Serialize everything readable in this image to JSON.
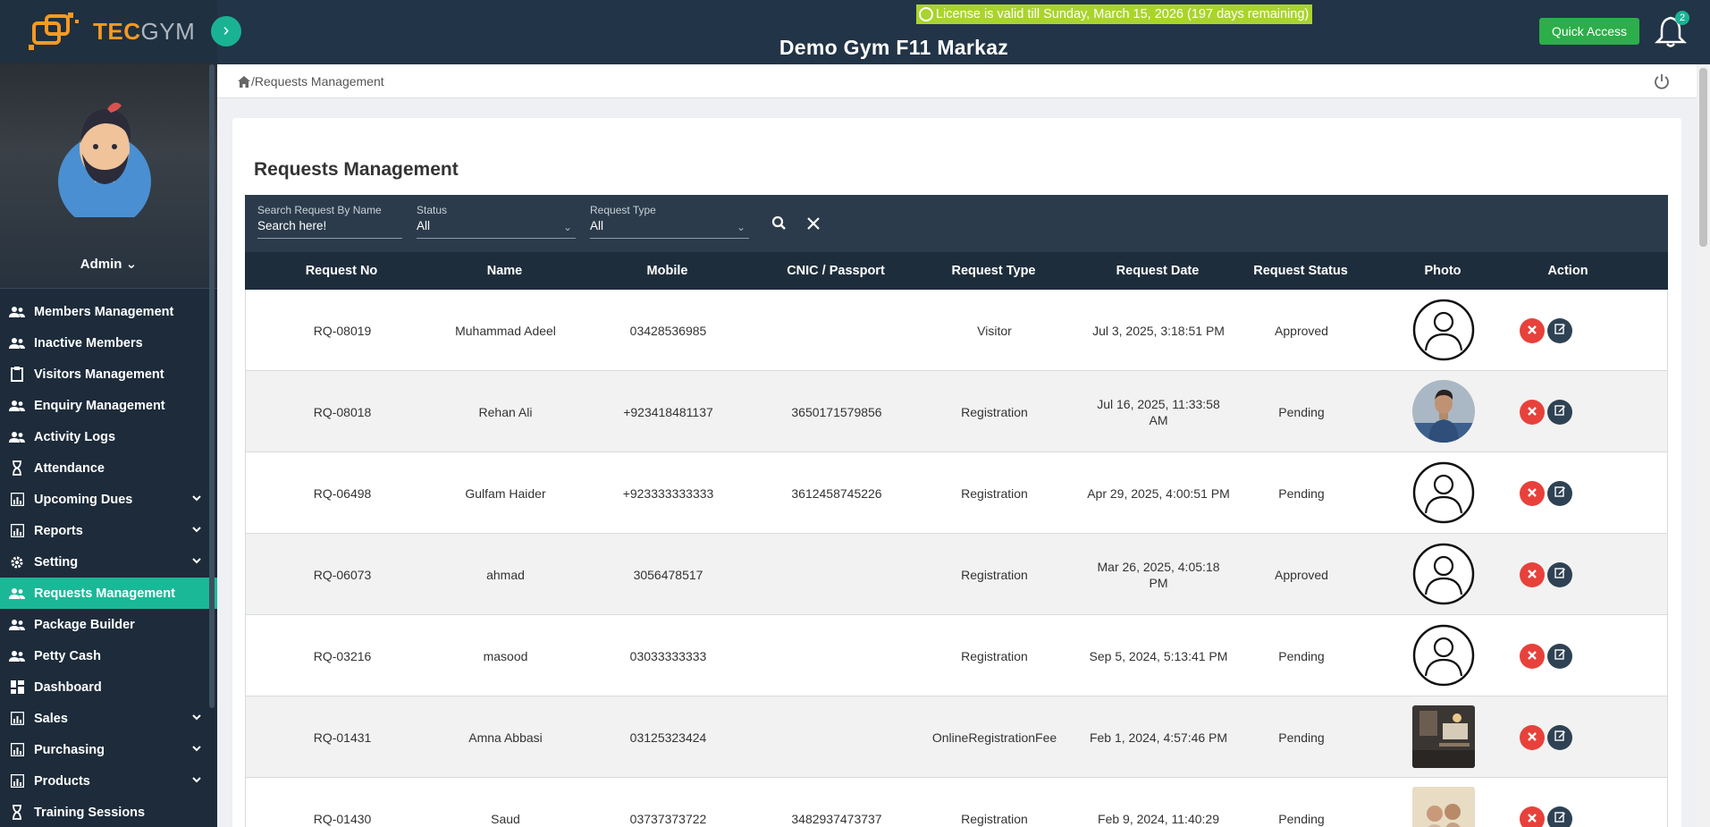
{
  "brand": {
    "logo_text_a": "TEC",
    "logo_text_b": "GYM"
  },
  "header": {
    "license": "License is valid till Sunday, March 15, 2026 (197 days remaining)",
    "gym_name": "Demo Gym F11 Markaz",
    "quick_access": "Quick Access",
    "notification_count": "2"
  },
  "profile": {
    "name": "Admin"
  },
  "sidebar": {
    "items": [
      {
        "label": "Members Management",
        "icon": "users-icon",
        "chevron": false,
        "active": false
      },
      {
        "label": "Inactive Members",
        "icon": "users-icon",
        "chevron": false,
        "active": false
      },
      {
        "label": "Visitors Management",
        "icon": "clipboard-icon",
        "chevron": false,
        "active": false
      },
      {
        "label": "Enquiry Management",
        "icon": "users-icon",
        "chevron": false,
        "active": false
      },
      {
        "label": "Activity Logs",
        "icon": "users-icon",
        "chevron": false,
        "active": false
      },
      {
        "label": "Attendance",
        "icon": "hourglass-icon",
        "chevron": false,
        "active": false
      },
      {
        "label": "Upcoming Dues",
        "icon": "chart-icon",
        "chevron": true,
        "active": false
      },
      {
        "label": "Reports",
        "icon": "chart-icon",
        "chevron": true,
        "active": false
      },
      {
        "label": "Setting",
        "icon": "gear-icon",
        "chevron": true,
        "active": false
      },
      {
        "label": "Requests Management",
        "icon": "users-icon",
        "chevron": false,
        "active": true
      },
      {
        "label": "Package Builder",
        "icon": "users-icon",
        "chevron": false,
        "active": false
      },
      {
        "label": "Petty Cash",
        "icon": "users-icon",
        "chevron": false,
        "active": false
      },
      {
        "label": "Dashboard",
        "icon": "dashboard-icon",
        "chevron": false,
        "active": false
      },
      {
        "label": "Sales",
        "icon": "chart-icon",
        "chevron": true,
        "active": false
      },
      {
        "label": "Purchasing",
        "icon": "chart-icon",
        "chevron": true,
        "active": false
      },
      {
        "label": "Products",
        "icon": "chart-icon",
        "chevron": true,
        "active": false
      },
      {
        "label": "Training Sessions",
        "icon": "hourglass-icon",
        "chevron": false,
        "active": false
      }
    ]
  },
  "breadcrumb": {
    "separator": "/",
    "current": "Requests Management"
  },
  "main": {
    "title": "Requests Management",
    "filters": {
      "search_label": "Search Request By Name",
      "search_placeholder": "Search here!",
      "status_label": "Status",
      "status_value": "All",
      "type_label": "Request Type",
      "type_value": "All"
    },
    "columns": [
      "Request No",
      "Name",
      "Mobile",
      "CNIC / Passport",
      "Request Type",
      "Request Date",
      "Request Status",
      "Photo",
      "Action"
    ],
    "rows": [
      {
        "no": "RQ-08019",
        "name": "Muhammad Adeel",
        "mobile": "03428536985",
        "cnic": "",
        "type": "Visitor",
        "date": "Jul 3, 2025, 3:18:51 PM",
        "status": "Approved",
        "photo": "placeholder"
      },
      {
        "no": "RQ-08018",
        "name": "Rehan Ali",
        "mobile": "+923418481137",
        "cnic": "3650171579856",
        "type": "Registration",
        "date": "Jul 16, 2025, 11:33:58 AM",
        "status": "Pending",
        "photo": "person-photo"
      },
      {
        "no": "RQ-06498",
        "name": "Gulfam Haider",
        "mobile": "+923333333333",
        "cnic": "3612458745226",
        "type": "Registration",
        "date": "Apr 29, 2025, 4:00:51 PM",
        "status": "Pending",
        "photo": "placeholder"
      },
      {
        "no": "RQ-06073",
        "name": "ahmad",
        "mobile": "3056478517",
        "cnic": "",
        "type": "Registration",
        "date": "Mar 26, 2025, 4:05:18 PM",
        "status": "Approved",
        "photo": "placeholder"
      },
      {
        "no": "RQ-03216",
        "name": "masood",
        "mobile": "03033333333",
        "cnic": "",
        "type": "Registration",
        "date": "Sep 5, 2024, 5:13:41 PM",
        "status": "Pending",
        "photo": "placeholder"
      },
      {
        "no": "RQ-01431",
        "name": "Amna Abbasi",
        "mobile": "03125323424",
        "cnic": "",
        "type": "OnlineRegistrationFee",
        "date": "Feb 1, 2024, 4:57:46 PM",
        "status": "Pending",
        "photo": "room-photo"
      },
      {
        "no": "RQ-01430",
        "name": "Saud",
        "mobile": "03737373722",
        "cnic": "3482937473737",
        "type": "Registration",
        "date": "Feb 9, 2024, 11:40:29",
        "status": "Pending",
        "photo": "group-photo"
      }
    ],
    "actions": {
      "delete_icon": "x-icon",
      "edit_icon": "edit-icon"
    }
  },
  "colors": {
    "accent": "#1bb897",
    "sidebar": "#1d2b3a",
    "header": "#223447",
    "license": "#a9d42c",
    "danger": "#e8413b"
  }
}
